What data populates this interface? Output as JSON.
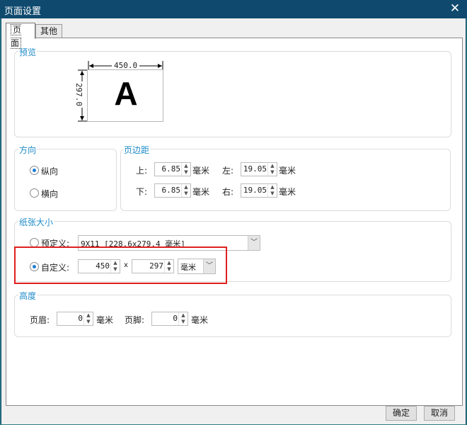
{
  "window": {
    "title": "页面设置",
    "close_glyph": "✕"
  },
  "tabs": [
    {
      "label": "页面"
    },
    {
      "label": "其他"
    }
  ],
  "preview": {
    "label": "预览",
    "width": "450.0",
    "height": "297.0",
    "sample": "A"
  },
  "orientation": {
    "label": "方向",
    "options": [
      {
        "label": "纵向",
        "selected": true
      },
      {
        "label": "横向",
        "selected": false
      }
    ]
  },
  "margins": {
    "label": "页边距",
    "top": {
      "label": "上:",
      "value": "6.85",
      "unit": "毫米"
    },
    "left": {
      "label": "左:",
      "value": "19.05",
      "unit": "毫米"
    },
    "bottom": {
      "label": "下:",
      "value": "6.85",
      "unit": "毫米"
    },
    "right": {
      "label": "右:",
      "value": "19.05",
      "unit": "毫米"
    }
  },
  "paper_size": {
    "label": "纸张大小",
    "predefined": {
      "label": "预定义:",
      "value": "9X11 [228.6x279.4 毫米]",
      "selected": false
    },
    "custom": {
      "label": "自定义:",
      "selected": true,
      "width": "450",
      "separator": "x",
      "height": "297",
      "unit": "毫米"
    }
  },
  "height": {
    "label": "高度",
    "header": {
      "label": "页眉:",
      "value": "0",
      "unit": "毫米"
    },
    "footer": {
      "label": "页脚:",
      "value": "0",
      "unit": "毫米"
    }
  },
  "buttons": {
    "ok": "确定",
    "cancel": "取消"
  },
  "colors": {
    "accent": "#1f8bc8",
    "highlight": "#e02020",
    "titlebar": "#0f4a6e"
  }
}
